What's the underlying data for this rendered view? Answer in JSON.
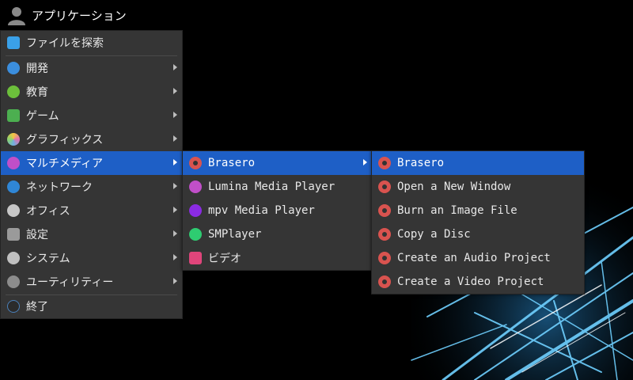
{
  "topbar": {
    "title": "アプリケーション",
    "icon": "user-icon"
  },
  "main_menu": {
    "file_search": "ファイルを探索",
    "items": [
      {
        "label": "開発",
        "icon": "hammer-icon",
        "color": "#3b8ede"
      },
      {
        "label": "教育",
        "icon": "apple-icon",
        "color": "#6cbf3b"
      },
      {
        "label": "ゲーム",
        "icon": "gamepad-icon",
        "color": "#4caf50"
      },
      {
        "label": "グラフィックス",
        "icon": "palette-icon",
        "color": "#e06fb0"
      },
      {
        "label": "マルチメディア",
        "icon": "music-icon",
        "color": "#c04fc8"
      },
      {
        "label": "ネットワーク",
        "icon": "globe-icon",
        "color": "#2f86d6"
      },
      {
        "label": "オフィス",
        "icon": "clip-icon",
        "color": "#c7c7c7"
      },
      {
        "label": "設定",
        "icon": "settings-icon",
        "color": "#9a9a9a"
      },
      {
        "label": "システム",
        "icon": "gear-icon",
        "color": "#bfbfbf"
      },
      {
        "label": "ユーティリティー",
        "icon": "tools-icon",
        "color": "#8c8c8c"
      }
    ],
    "logout": "終了"
  },
  "multimedia_menu": {
    "items": [
      {
        "label": "Brasero",
        "icon": "disc-icon"
      },
      {
        "label": "Lumina Media Player",
        "icon": "music-icon"
      },
      {
        "label": "mpv Media Player",
        "icon": "play-icon"
      },
      {
        "label": "SMPlayer",
        "icon": "smplayer-icon"
      },
      {
        "label": "ビデオ",
        "icon": "video-icon"
      }
    ]
  },
  "brasero_menu": {
    "items": [
      {
        "label": "Brasero"
      },
      {
        "label": "Open a New Window"
      },
      {
        "label": "Burn an Image File"
      },
      {
        "label": "Copy a Disc"
      },
      {
        "label": "Create an Audio Project"
      },
      {
        "label": "Create a Video Project"
      }
    ]
  },
  "colors": {
    "highlight": "#1e5fc6",
    "menu_bg": "#353535"
  }
}
